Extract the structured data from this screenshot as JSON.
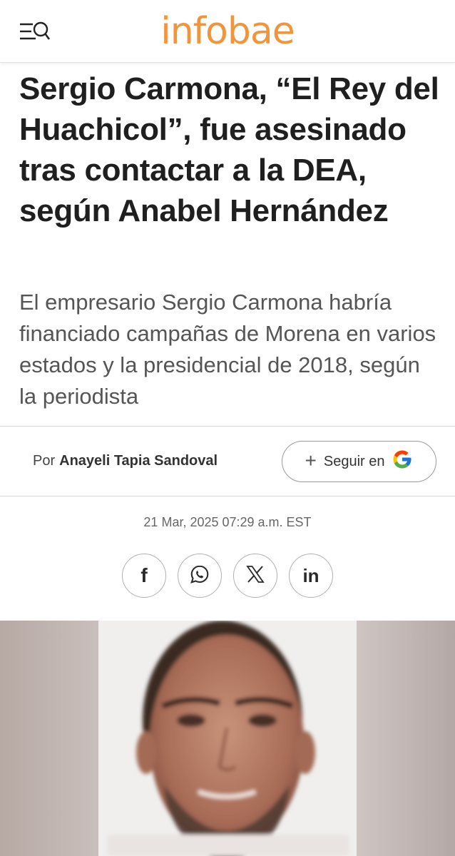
{
  "header": {
    "logo": "infobae",
    "logo_color": "#f0953b",
    "menu_icon": "menu-search-icon"
  },
  "article": {
    "headline": "Sergio Carmona, “El Rey del Huachicol”, fue asesinado tras contactar a la DEA, según Anabel Hernández",
    "subtitle": "El empresario Sergio Carmona habría financiado campañas de Morena en varios estados y la presidencial de 2018, según la periodista",
    "byline_prefix": "Por",
    "author": "Anayeli Tapia Sandoval",
    "follow_label": "Seguir en",
    "follow_icon": "google-icon",
    "date": "21 Mar, 2025 07:29 a.m. EST"
  },
  "share": {
    "facebook": "f",
    "whatsapp_icon": "whatsapp-icon",
    "x": "𝕏",
    "linkedin": "in"
  },
  "image": {
    "description_icon": "article-photo"
  }
}
